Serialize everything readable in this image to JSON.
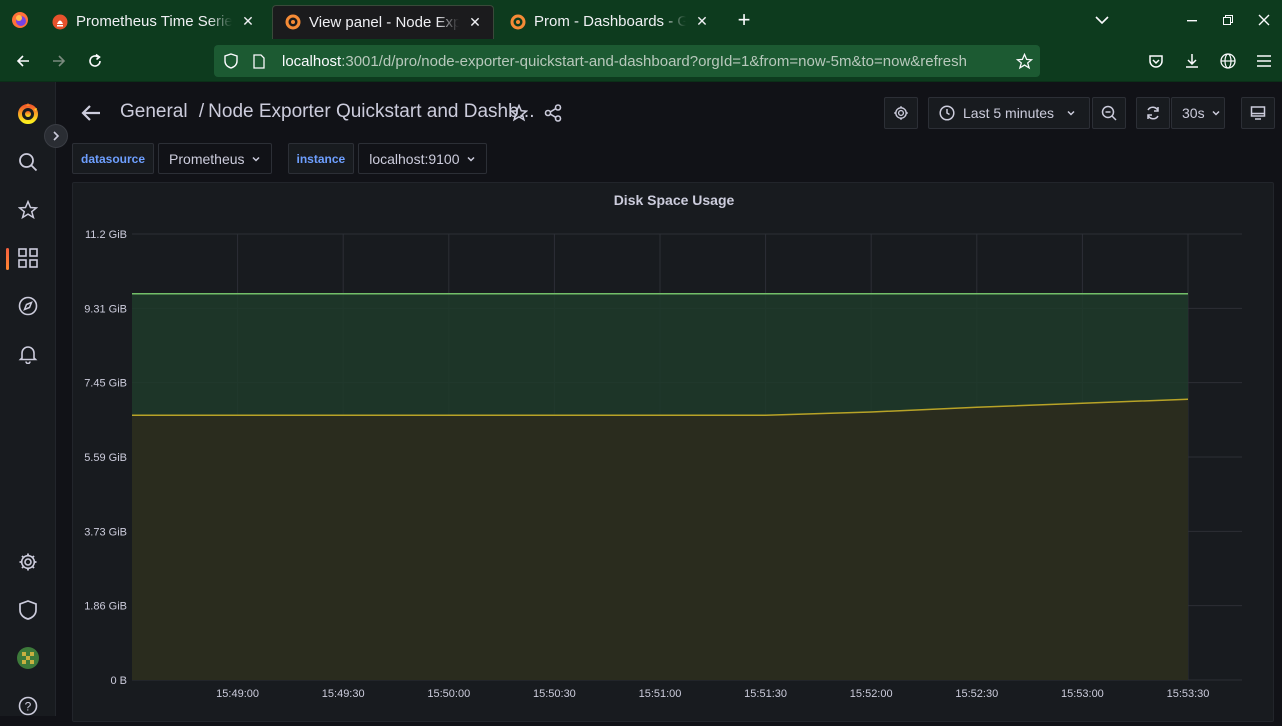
{
  "browser": {
    "tabs": [
      {
        "title": "Prometheus Time Series",
        "active": false
      },
      {
        "title": "View panel - Node Exporter",
        "active": true
      },
      {
        "title": "Prom - Dashboards - Grafana",
        "active": false
      }
    ],
    "url_host": "localhost",
    "url_rest": ":3001/d/pro/node-exporter-quickstart-and-dashboard?orgId=1&from=now-5m&to=now&refresh"
  },
  "header": {
    "breadcrumb_folder": "General",
    "breadcrumb_sep": "/",
    "dashboard_title": "Node Exporter Quickstart and Dashb...",
    "time_range": "Last 5 minutes",
    "refresh_interval": "30s"
  },
  "variables": [
    {
      "label": "datasource",
      "value": "Prometheus"
    },
    {
      "label": "instance",
      "value": "localhost:9100"
    }
  ],
  "panel": {
    "title": "Disk Space Usage"
  },
  "chart_data": {
    "type": "area",
    "title": "Disk Space Usage",
    "y_tick_labels": [
      "0 B",
      "1.86 GiB",
      "3.73 GiB",
      "5.59 GiB",
      "7.45 GiB",
      "9.31 GiB",
      "11.2 GiB"
    ],
    "ylim_gib": [
      0,
      11.2
    ],
    "x_tick_labels": [
      "15:49:00",
      "15:49:30",
      "15:50:00",
      "15:50:30",
      "15:51:00",
      "15:51:30",
      "15:52:00",
      "15:52:30",
      "15:53:00",
      "15:53:30"
    ],
    "x": [
      "15:48:30",
      "15:49:00",
      "15:49:30",
      "15:50:00",
      "15:50:30",
      "15:51:00",
      "15:51:30",
      "15:52:00",
      "15:52:30",
      "15:53:00",
      "15:53:30"
    ],
    "series": [
      {
        "color": "#73bf69",
        "fill": "#1f3a2a",
        "values_gib": [
          9.7,
          9.7,
          9.7,
          9.7,
          9.7,
          9.7,
          9.7,
          9.7,
          9.7,
          9.7,
          9.7
        ]
      },
      {
        "color": "#b8a327",
        "fill": "#2d2a1c",
        "values_gib": [
          6.65,
          6.65,
          6.65,
          6.65,
          6.65,
          6.65,
          6.65,
          6.73,
          6.85,
          6.95,
          7.05
        ]
      }
    ],
    "grid": true
  }
}
